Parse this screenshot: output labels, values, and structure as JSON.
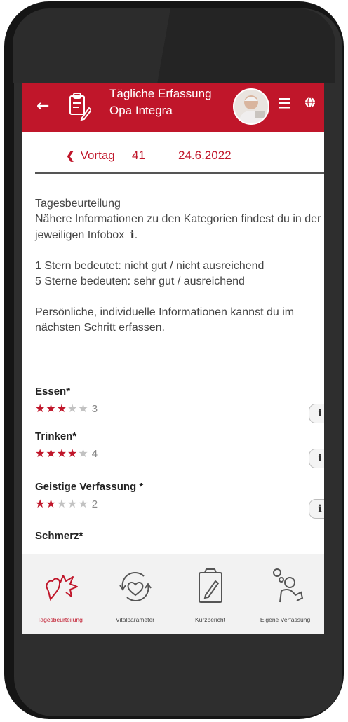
{
  "header": {
    "back_icon": "arrow-left-icon",
    "title": "Tägliche Erfassung",
    "subtitle": "Opa Integra",
    "menu_icon": "hamburger-icon",
    "language_icon": "globe-icon",
    "accent_color": "#c0162a"
  },
  "date_nav": {
    "prev_label": "Vortag",
    "day_number": "41",
    "date": "24.6.2022"
  },
  "info": {
    "line1": "Tagesbeurteilung",
    "line2": "Nähere Informationen zu den Kategorien findest du in der jeweiligen Infobox",
    "info_symbol": "i",
    "line2_end": ".",
    "line3": "1 Stern bedeutet: nicht gut / nicht ausreichend",
    "line4": "5 Sterne bedeuten: sehr gut / ausreichend",
    "line5": "Persönliche, individuelle Informationen kannst du im nächsten Schritt erfassen."
  },
  "categories": [
    {
      "label": "Essen*",
      "rating": 3,
      "value": "3",
      "info": "i"
    },
    {
      "label": "Trinken*",
      "rating": 4,
      "value": "4",
      "info": "i"
    },
    {
      "label": "Geistige Verfassung *",
      "rating": 2,
      "value": "2",
      "info": "i"
    },
    {
      "label": "Schmerz*"
    }
  ],
  "tabs": [
    {
      "label": "Tagesbeurteilung",
      "icon": "hearts-icon",
      "active": true
    },
    {
      "label": "Vitalparameter",
      "icon": "heart-cycle-icon",
      "active": false
    },
    {
      "label": "Kurzbericht",
      "icon": "clipboard-pen-icon",
      "active": false
    },
    {
      "label": "Eigene Verfassung",
      "icon": "person-thought-icon",
      "active": false
    }
  ]
}
